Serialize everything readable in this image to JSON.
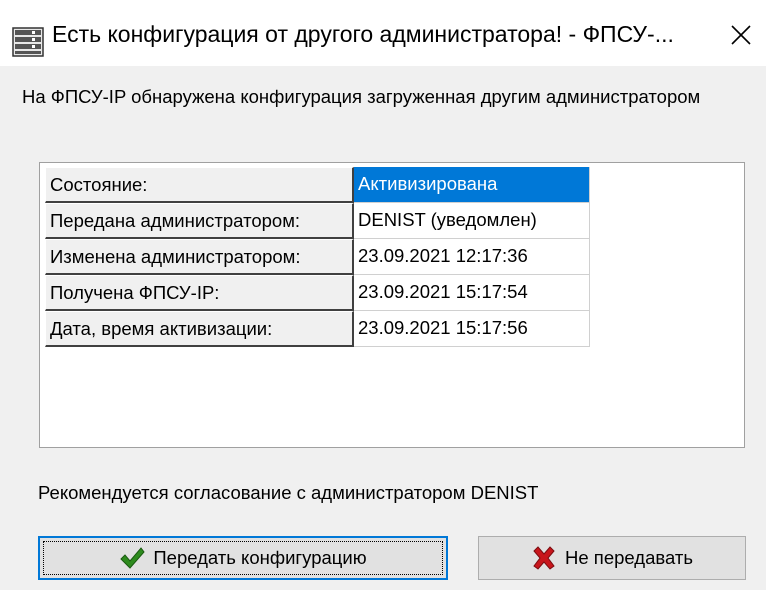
{
  "window": {
    "title": "Есть конфигурация от другого администратора! - ФПСУ-...",
    "close_glyph": "✕"
  },
  "message": "На ФПСУ-IP обнаружена конфигурация загруженная другим администратором",
  "table": {
    "rows": [
      {
        "label": "Состояние:",
        "value": "Активизирована"
      },
      {
        "label": "Передана администратором:",
        "value": "DENIST (уведомлен)"
      },
      {
        "label": "Изменена администратором:",
        "value": "23.09.2021 12:17:36"
      },
      {
        "label": "Получена ФПСУ-IP:",
        "value": "23.09.2021 15:17:54"
      },
      {
        "label": "Дата, время активизации:",
        "value": "23.09.2021 15:17:56"
      }
    ]
  },
  "recommendation": "Рекомендуется согласование с администратором DENIST",
  "buttons": {
    "send_label": "Передать конфигурацию",
    "send_icon": "checkmark-icon",
    "dont_send_label": "Не передавать",
    "dont_send_icon": "red-x-icon"
  },
  "colors": {
    "selection": "#0078d7",
    "check_green": "#2e8b1e",
    "cross_red": "#c8161c"
  }
}
